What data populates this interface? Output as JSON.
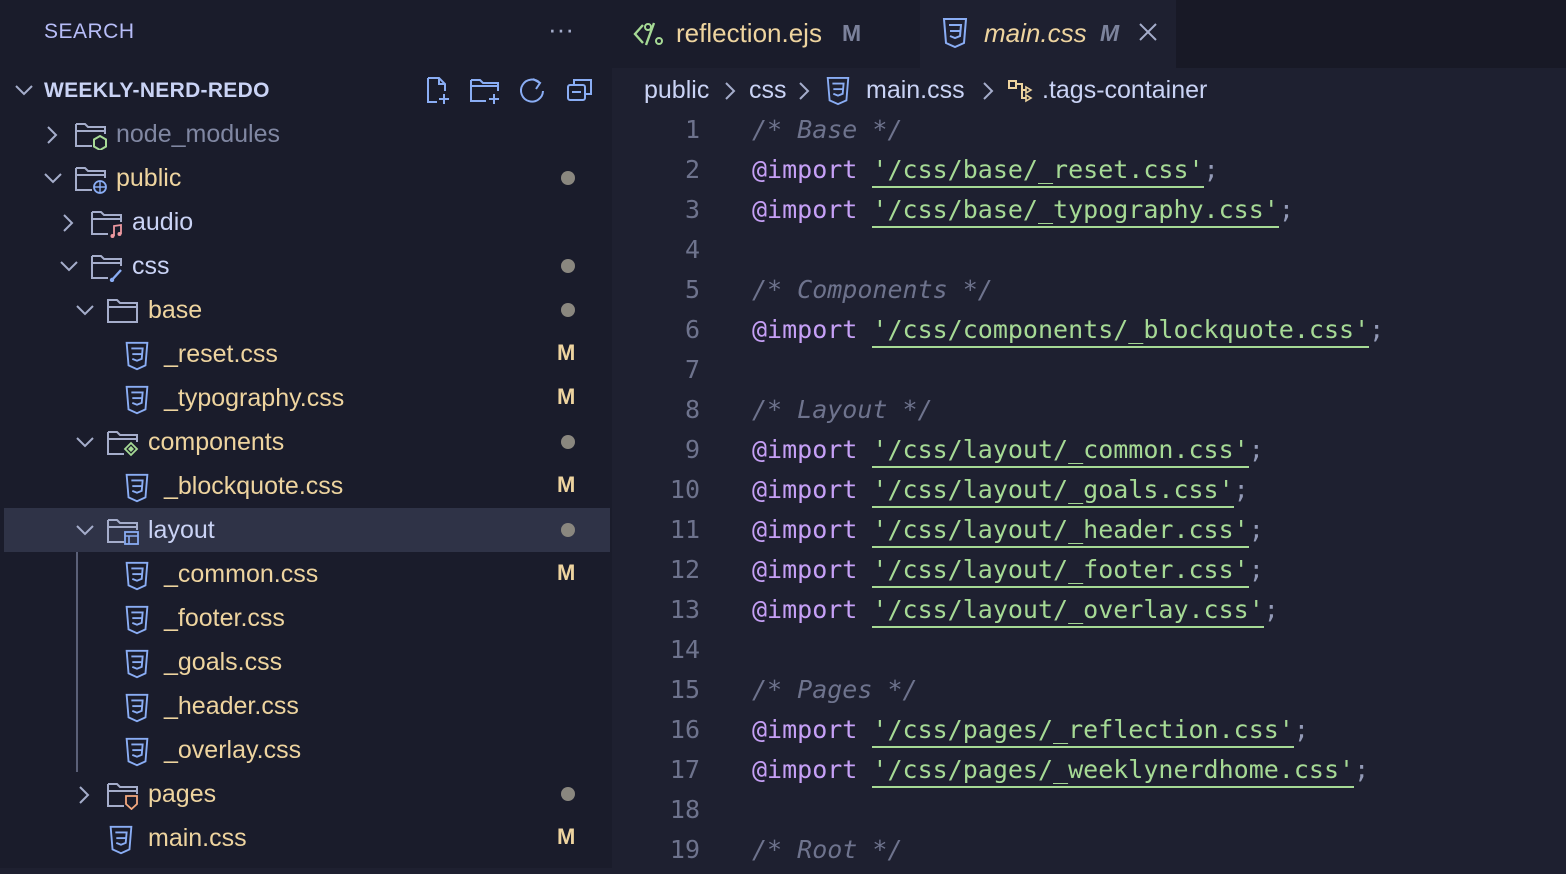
{
  "sidebar": {
    "title": "SEARCH",
    "more_label": "···",
    "project_name": "WEEKLY-NERD-REDO",
    "tree": [
      {
        "label": "node_modules",
        "kind": "folder",
        "icon": "folder-node-icon",
        "expanded": false,
        "depth": 0,
        "badge": "",
        "dot": false,
        "muted": true
      },
      {
        "label": "public",
        "kind": "folder",
        "icon": "folder-public-icon",
        "expanded": true,
        "depth": 0,
        "badge": "",
        "dot": true
      },
      {
        "label": "audio",
        "kind": "folder",
        "icon": "folder-audio-icon",
        "expanded": false,
        "depth": 1,
        "badge": "",
        "dot": false
      },
      {
        "label": "css",
        "kind": "folder",
        "icon": "folder-css-icon",
        "expanded": true,
        "depth": 1,
        "badge": "",
        "dot": true
      },
      {
        "label": "base",
        "kind": "folder",
        "icon": "folder-icon",
        "expanded": true,
        "depth": 2,
        "badge": "",
        "dot": true
      },
      {
        "label": "_reset.css",
        "kind": "file",
        "icon": "css-file-icon",
        "depth": 3,
        "badge": "M",
        "dot": false
      },
      {
        "label": "_typography.css",
        "kind": "file",
        "icon": "css-file-icon",
        "depth": 3,
        "badge": "M",
        "dot": false
      },
      {
        "label": "components",
        "kind": "folder",
        "icon": "folder-components-icon",
        "expanded": true,
        "depth": 2,
        "badge": "",
        "dot": true
      },
      {
        "label": "_blockquote.css",
        "kind": "file",
        "icon": "css-file-icon",
        "depth": 3,
        "badge": "M",
        "dot": false
      },
      {
        "label": "layout",
        "kind": "folder",
        "icon": "folder-layout-icon",
        "expanded": true,
        "depth": 2,
        "badge": "",
        "dot": true,
        "selected": true
      },
      {
        "label": "_common.css",
        "kind": "file",
        "icon": "css-file-icon",
        "depth": 3,
        "badge": "M",
        "dot": false
      },
      {
        "label": "_footer.css",
        "kind": "file",
        "icon": "css-file-icon",
        "depth": 3,
        "badge": "",
        "dot": false
      },
      {
        "label": "_goals.css",
        "kind": "file",
        "icon": "css-file-icon",
        "depth": 3,
        "badge": "",
        "dot": false
      },
      {
        "label": "_header.css",
        "kind": "file",
        "icon": "css-file-icon",
        "depth": 3,
        "badge": "",
        "dot": false
      },
      {
        "label": "_overlay.css",
        "kind": "file",
        "icon": "css-file-icon",
        "depth": 3,
        "badge": "",
        "dot": false
      },
      {
        "label": "pages",
        "kind": "folder",
        "icon": "folder-pages-icon",
        "expanded": false,
        "depth": 2,
        "badge": "",
        "dot": true
      },
      {
        "label": "main.css",
        "kind": "file",
        "icon": "css-file-icon",
        "depth": 2,
        "badge": "M",
        "dot": false
      }
    ]
  },
  "tabs": [
    {
      "name": "reflection.ejs",
      "modified": "M",
      "icon": "ejs-file-icon",
      "active": false
    },
    {
      "name": "main.css",
      "modified": "M",
      "icon": "css-file-icon",
      "active": true,
      "close": "×"
    }
  ],
  "breadcrumb": [
    "public",
    "css",
    "main.css",
    ".tags-container"
  ],
  "code_lines": [
    {
      "n": "1",
      "type": "comment",
      "text": "/* Base */"
    },
    {
      "n": "2",
      "type": "import",
      "kw": "@import",
      "str": "'/css/base/_reset.css'",
      "end": ";"
    },
    {
      "n": "3",
      "type": "import",
      "kw": "@import",
      "str": "'/css/base/_typography.css'",
      "end": ";"
    },
    {
      "n": "4",
      "type": "blank"
    },
    {
      "n": "5",
      "type": "comment",
      "text": "/* Components */"
    },
    {
      "n": "6",
      "type": "import",
      "kw": "@import",
      "str": "'/css/components/_blockquote.css'",
      "end": ";"
    },
    {
      "n": "7",
      "type": "blank"
    },
    {
      "n": "8",
      "type": "comment",
      "text": "/* Layout */"
    },
    {
      "n": "9",
      "type": "import",
      "kw": "@import",
      "str": "'/css/layout/_common.css'",
      "end": ";"
    },
    {
      "n": "10",
      "type": "import",
      "kw": "@import",
      "str": "'/css/layout/_goals.css'",
      "end": ";"
    },
    {
      "n": "11",
      "type": "import",
      "kw": "@import",
      "str": "'/css/layout/_header.css'",
      "end": ";"
    },
    {
      "n": "12",
      "type": "import",
      "kw": "@import",
      "str": "'/css/layout/_footer.css'",
      "end": ";"
    },
    {
      "n": "13",
      "type": "import",
      "kw": "@import",
      "str": "'/css/layout/_overlay.css'",
      "end": ";"
    },
    {
      "n": "14",
      "type": "blank"
    },
    {
      "n": "15",
      "type": "comment",
      "text": "/* Pages */"
    },
    {
      "n": "16",
      "type": "import",
      "kw": "@import",
      "str": "'/css/pages/_reflection.css'",
      "end": ";"
    },
    {
      "n": "17",
      "type": "import",
      "kw": "@import",
      "str": "'/css/pages/_weeklynerdhome.css'",
      "end": ";"
    },
    {
      "n": "18",
      "type": "blank"
    },
    {
      "n": "19",
      "type": "comment",
      "text": "/* Root */"
    }
  ],
  "colors": {
    "background": "#1e2030",
    "sidebar": "#1a1c2b",
    "folder_text": "#eed49f",
    "file_text": "#eed49f",
    "keyword": "#c6a0f6",
    "string": "#a6da95",
    "comment": "#6e738d",
    "accent": "#b7bdf8"
  }
}
